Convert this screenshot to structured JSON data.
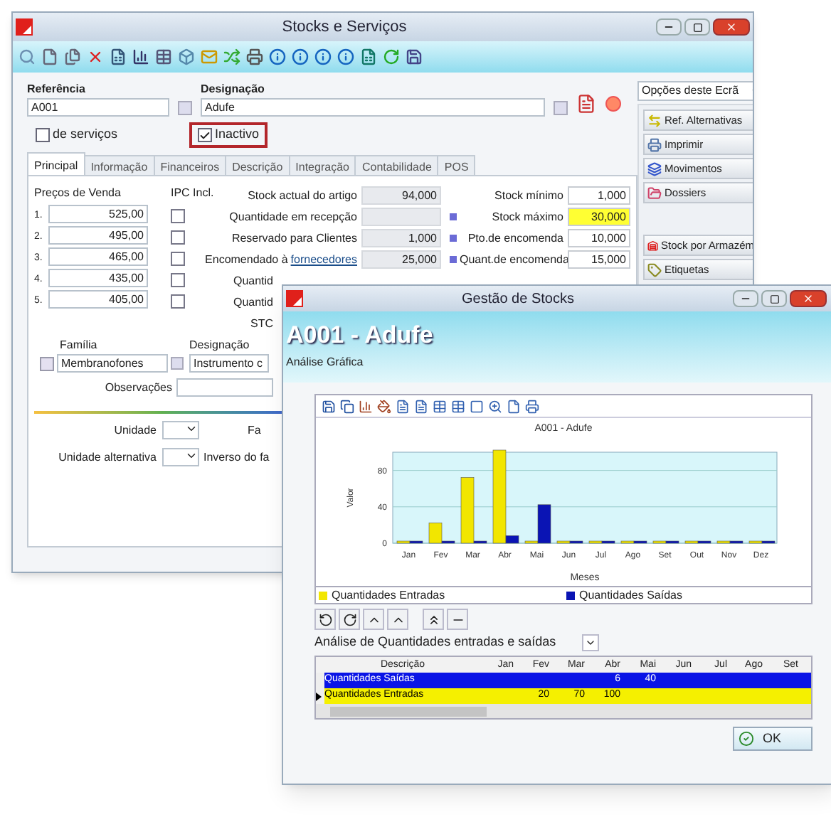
{
  "back_window": {
    "title": "Stocks e Serviços",
    "referencia": {
      "label": "Referência",
      "value": "A001"
    },
    "designacao": {
      "label": "Designação",
      "value": "Adufe"
    },
    "checkboxes": [
      {
        "label": "de serviços",
        "checked": false,
        "highlighted": false
      },
      {
        "label": "Inactivo",
        "checked": true,
        "highlighted": true
      }
    ],
    "tabs": [
      {
        "label": "Principal",
        "selected": true
      },
      {
        "label": "Informação",
        "selected": false
      },
      {
        "label": "Financeiros",
        "selected": false
      },
      {
        "label": "Descrição",
        "selected": false
      },
      {
        "label": "Integração",
        "selected": false
      },
      {
        "label": "Contabilidade",
        "selected": false
      },
      {
        "label": "POS",
        "selected": false
      }
    ],
    "prices": {
      "label": "Preços de Venda",
      "ipc_label": "IPC Incl.",
      "rows": [
        {
          "index": "1.",
          "value": "525,00",
          "checked": false
        },
        {
          "index": "2.",
          "value": "495,00",
          "checked": false
        },
        {
          "index": "3.",
          "value": "465,00",
          "checked": false
        },
        {
          "index": "4.",
          "value": "435,00",
          "checked": false
        },
        {
          "index": "5.",
          "value": "405,00",
          "checked": false
        }
      ]
    },
    "stock_fields": [
      {
        "label": "Stock actual do artigo",
        "value": "94,000"
      },
      {
        "label": "Quantidade em recepção"
      },
      {
        "label": "Reservado para Clientes",
        "value": "1,000"
      },
      {
        "label": "Encomendado à",
        "link": "fornecedores",
        "value": "25,000"
      },
      {
        "label": "Quantid"
      },
      {
        "label": "Quantid"
      },
      {
        "label": "STC"
      }
    ],
    "limits": [
      {
        "label": "Stock mínimo",
        "value": "1,000",
        "highlighted": false
      },
      {
        "label": "Stock máximo",
        "value": "30,000",
        "highlighted": true
      },
      {
        "label": "Pto.de encomenda",
        "value": "10,000",
        "highlighted": false
      },
      {
        "label": "Quant.de encomenda",
        "value": "15,000",
        "highlighted": false
      }
    ],
    "familia": {
      "label": "Família",
      "value": "Membranofones",
      "designacao_label": "Designação",
      "designacao_value": "Instrumento c"
    },
    "observacoes": {
      "label": "Observações"
    },
    "unidade": {
      "label": "Unidade",
      "factor_label": "Fa"
    },
    "unidade_alternativa": {
      "label": "Unidade alternativa",
      "factor_label": "Inverso do fa"
    },
    "options": {
      "dropdown": "Opções deste Ecrã",
      "buttons": [
        {
          "label": "Ref. Alternativas",
          "kind": "alternatives"
        },
        {
          "label": "Imprimir",
          "kind": "print"
        },
        {
          "label": "Movimentos",
          "kind": "movements"
        },
        {
          "label": "Dossiers",
          "kind": "dossiers"
        },
        {
          "label": "Stock por Armazém",
          "kind": "warehouse"
        },
        {
          "label": "Etiquetas",
          "kind": "labels"
        }
      ]
    }
  },
  "front_window": {
    "title": "Gestão de Stocks",
    "heading": "A001 - Adufe",
    "subheading": "Análise Gráfica",
    "chart": {
      "chart_data": {
        "type": "bar",
        "title": "A001 - Adufe",
        "xlabel": "Meses",
        "ylabel": "Valor",
        "categories": [
          "Jan",
          "Fev",
          "Mar",
          "Abr",
          "Mai",
          "Jun",
          "Jul",
          "Ago",
          "Set",
          "Out",
          "Nov",
          "Dez"
        ],
        "series": [
          {
            "name": "Quantidades Entradas",
            "color": "#f2e600",
            "values": [
              0,
              20,
              70,
              100,
              0,
              0,
              0,
              0,
              0,
              0,
              0,
              0
            ]
          },
          {
            "name": "Quantidades Saídas",
            "color": "#0a14b4",
            "values": [
              0,
              0,
              0,
              6,
              40,
              0,
              0,
              0,
              0,
              0,
              0,
              0
            ]
          }
        ],
        "ylim": [
          0,
          100
        ],
        "yticks": [
          0,
          40,
          80
        ]
      }
    },
    "analysis_dropdown": "Análise de Quantidades entradas e saídas",
    "table": {
      "columns": [
        "Descrição",
        "Jan",
        "Fev",
        "Mar",
        "Abr",
        "Mai",
        "Jun",
        "Jul",
        "Ago",
        "Set"
      ],
      "rows": [
        {
          "color": "#0a14e6",
          "selected": false,
          "cells": [
            "Quantidades Saídas",
            null,
            null,
            null,
            "6",
            "40",
            null,
            null,
            null,
            null
          ]
        },
        {
          "color": "#f5f000",
          "selected": true,
          "cells": [
            "Quantidades Entradas",
            null,
            "20",
            "70",
            "100",
            null,
            null,
            null,
            null,
            null
          ]
        }
      ]
    },
    "ok_button": "OK"
  }
}
